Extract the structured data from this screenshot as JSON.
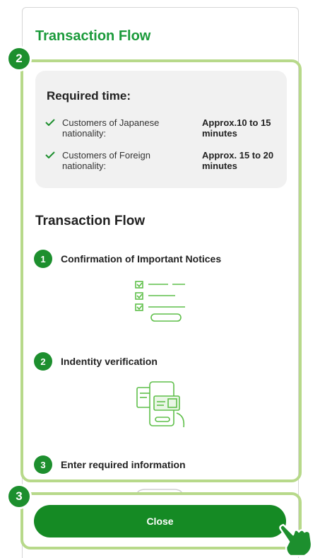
{
  "header": {
    "title": "Transaction Flow"
  },
  "callouts": {
    "main_number": "2",
    "close_number": "3"
  },
  "required_time": {
    "title": "Required time:",
    "rows": [
      {
        "label": "Customers of Japanese nationality:",
        "value": "Approx.10 to 15 minutes"
      },
      {
        "label": "Customers of Foreign nationality:",
        "value": "Approx. 15 to 20 minutes"
      }
    ]
  },
  "flow": {
    "heading": "Transaction Flow",
    "steps": [
      {
        "number": "1",
        "label": "Confirmation of Important Notices",
        "icon": "checklist-icon"
      },
      {
        "number": "2",
        "label": "Indentity verification",
        "icon": "id-card-phone-icon"
      },
      {
        "number": "3",
        "label": "Enter required information",
        "icon": "form-icon"
      }
    ]
  },
  "footer": {
    "close_label": "Close"
  },
  "colors": {
    "brand_green": "#1d8f2e",
    "highlight": "#b7d98a",
    "illustration": "#5fbf4a"
  }
}
